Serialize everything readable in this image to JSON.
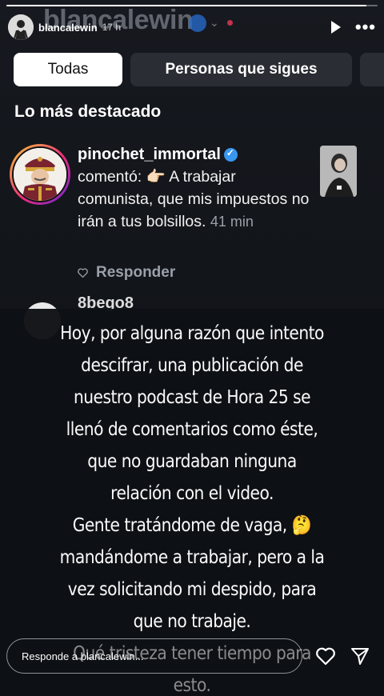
{
  "story": {
    "progress_fraction": 0.97,
    "ghost_username": "blancalewin",
    "username": "blancalewin",
    "time": "17 h"
  },
  "tabs": [
    {
      "label": "Todas",
      "active": true
    },
    {
      "label": "Personas que sigues",
      "active": false
    }
  ],
  "section_title": "Lo más destacado",
  "notification": {
    "username": "pinochet_immortal",
    "text": "comentó: 👉🏻 A trabajar comunista, que mis impuestos no irán a tus bolsillos.",
    "time": "41 min",
    "reply_label": "Responder"
  },
  "notification2": {
    "username": "8bego8"
  },
  "overlay": {
    "lines": [
      "Hoy, por alguna razón que intento",
      "descifrar, una publicación de",
      "nuestro podcast de Hora 25 se",
      "llenó de comentarios como éste,",
      "que no guardaban ninguna",
      "relación con el video.",
      "Gente tratándome de vaga, 🤔",
      "mandándome a trabajar, pero a la",
      "vez solicitando mi despido, para",
      "que no trabaje.",
      "Qué tristeza tener tiempo para",
      "esto."
    ]
  },
  "reply_bar": {
    "placeholder": "Responde a blancalewin..."
  },
  "colors": {
    "verified": "#3897f0",
    "ring_start": "#f9ce34",
    "ring_mid": "#ee2a7b",
    "ring_end": "#6228d7"
  }
}
